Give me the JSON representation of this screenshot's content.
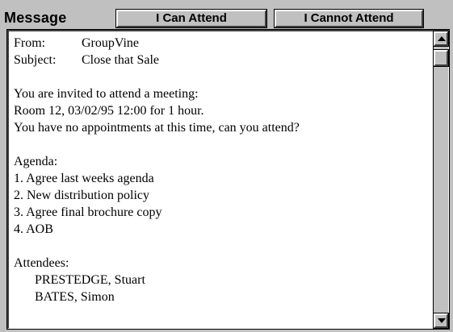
{
  "window": {
    "title": "Message"
  },
  "toolbar": {
    "attend_label": "I Can Attend",
    "cannot_attend_label": "I Cannot Attend"
  },
  "message": {
    "from_label": "From:",
    "from_value": "GroupVine",
    "subject_label": "Subject:",
    "subject_value": "Close that Sale",
    "body_lines": [
      "You are invited to attend a meeting:",
      "Room 12, 03/02/95 12:00 for 1 hour.",
      "You have no appointments at this time, can you attend?"
    ],
    "agenda_heading": "Agenda:",
    "agenda_items": [
      "1. Agree last weeks agenda",
      "2. New distribution policy",
      "3. Agree final brochure copy",
      "4. AOB"
    ],
    "attendees_heading": "Attendees:",
    "attendees": [
      "PRESTEDGE, Stuart",
      "BATES, Simon"
    ]
  },
  "icons": {
    "scroll_up": "arrow-up-icon",
    "scroll_down": "arrow-down-icon"
  }
}
